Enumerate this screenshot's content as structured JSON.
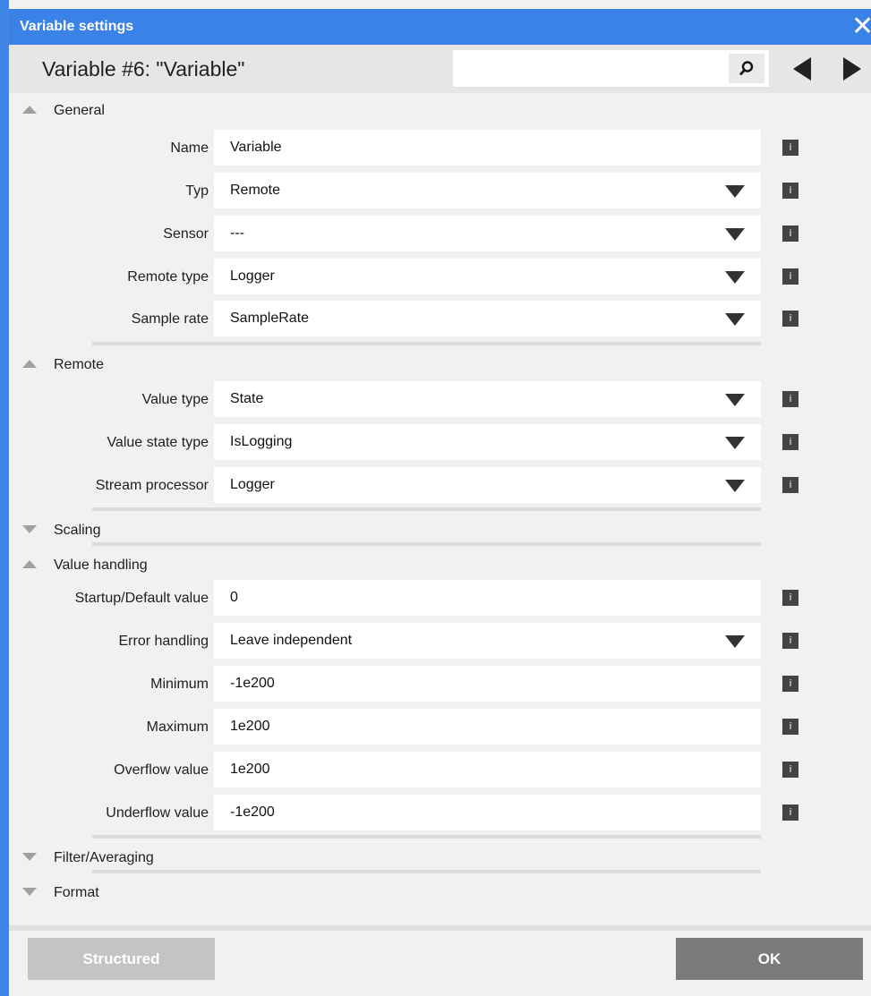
{
  "window": {
    "title": "Variable settings",
    "close_glyph": "✕"
  },
  "header": {
    "title": "Variable #6: \"Variable\"",
    "search_value": "",
    "search_icon": "search-icon",
    "prev_icon": "arrow-left-icon",
    "next_icon": "arrow-right-icon"
  },
  "sections": {
    "general": {
      "label": "General",
      "expanded": true,
      "rows": {
        "name": {
          "label": "Name",
          "value": "Variable"
        },
        "typ": {
          "label": "Typ",
          "value": "Remote"
        },
        "sensor": {
          "label": "Sensor",
          "value": "---"
        },
        "remote_type": {
          "label": "Remote type",
          "value": "Logger"
        },
        "sample_rate": {
          "label": "Sample rate",
          "value": "SampleRate"
        }
      }
    },
    "remote": {
      "label": "Remote",
      "expanded": true,
      "rows": {
        "value_type": {
          "label": "Value type",
          "value": "State"
        },
        "value_state_type": {
          "label": "Value state type",
          "value": "IsLogging"
        },
        "stream_processor": {
          "label": "Stream processor",
          "value": "Logger"
        }
      }
    },
    "scaling": {
      "label": "Scaling",
      "expanded": false
    },
    "value_handling": {
      "label": "Value handling",
      "expanded": true,
      "rows": {
        "startup_default": {
          "label": "Startup/Default value",
          "value": "0"
        },
        "error_handling": {
          "label": "Error handling",
          "value": "Leave independent"
        },
        "minimum": {
          "label": "Minimum",
          "value": "-1e200"
        },
        "maximum": {
          "label": "Maximum",
          "value": "1e200"
        },
        "overflow": {
          "label": "Overflow value",
          "value": "1e200"
        },
        "underflow": {
          "label": "Underflow value",
          "value": "-1e200"
        }
      }
    },
    "filter": {
      "label": "Filter/Averaging",
      "expanded": false
    },
    "format": {
      "label": "Format",
      "expanded": false
    }
  },
  "info_glyph": "i",
  "footer": {
    "structured_label": "Structured",
    "ok_label": "OK"
  },
  "colors": {
    "accent": "#3b82e6",
    "panel": "#f1f1f1",
    "ok_button": "#7b7b7b",
    "structured_button": "#c4c4c4"
  }
}
